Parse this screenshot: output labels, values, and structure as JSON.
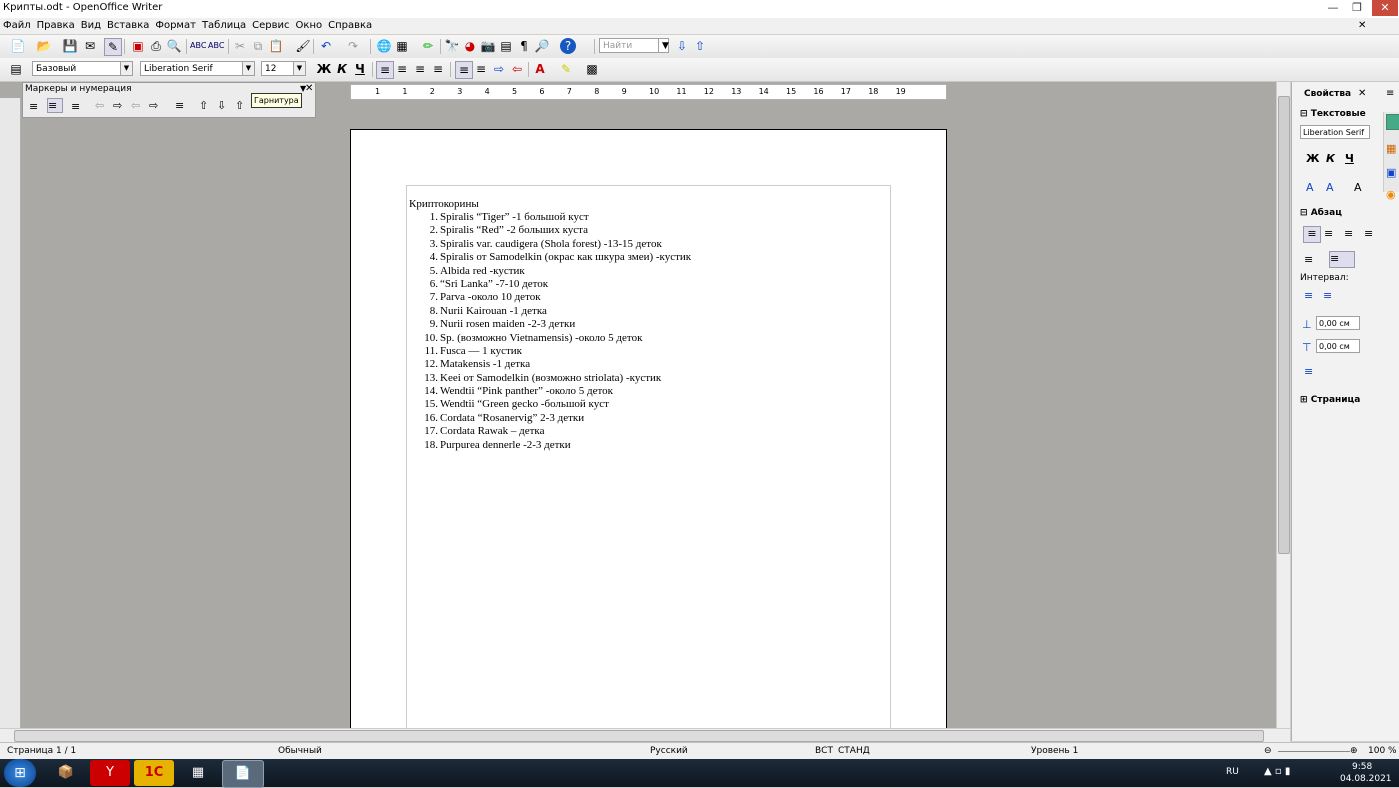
{
  "window": {
    "title": "Крипты.odt - OpenOffice Writer"
  },
  "menu": [
    "Файл",
    "Правка",
    "Вид",
    "Вставка",
    "Формат",
    "Таблица",
    "Сервис",
    "Окно",
    "Справка"
  ],
  "toolbar": {
    "search_placeholder": "Найти",
    "style_value": "Базовый",
    "font_value": "Liberation Serif",
    "size_value": "12",
    "bold_label": "Ж",
    "italic_label": "К",
    "underline_label": "Ч"
  },
  "bullets_toolbar": {
    "title": "Маркеры и нумерация",
    "tooltip": "Гарнитура"
  },
  "ruler": {
    "marks": [
      "1",
      "1",
      "2",
      "3",
      "4",
      "5",
      "6",
      "7",
      "8",
      "9",
      "10",
      "11",
      "12",
      "13",
      "14",
      "15",
      "16",
      "17",
      "18",
      "19"
    ]
  },
  "document": {
    "heading": "Криптокорины",
    "items": [
      "Spiralis “Tiger” -1 большой куст",
      "Spiralis “Red” -2 больших куста",
      "Spiralis var. caudigera (Shola forest) -13-15 деток",
      "Spiralis от Samodelkin (окрас как шкура змеи) -кустик",
      "Albida red -кустик",
      "“Sri Lanka” -7-10 деток",
      "Parva -около 10 деток",
      "Nurii Kairouan -1 детка",
      "Nurii rosen maiden -2-3 детки",
      "Sp. (возможно Vietnamensis) -около 5 деток",
      "Fusca — 1 кустик",
      "Matakensis -1 детка",
      "Keei  от Samodelkin (возможно striolata) -кустик",
      "Wendtii “Pink panther” -около 5 деток",
      "Wendtii “Green gecko -большой куст",
      "Cordata “Rosanervig” 2-3 детки",
      "Cordata Rawak – детка",
      "Purpurea dennerle -2-3 детки"
    ]
  },
  "sidebar": {
    "title": "Свойства",
    "text_section": "Текстовые",
    "font_value": "Liberation Serif",
    "bold": "Ж",
    "italic": "К",
    "underline": "Ч",
    "paragraph_section": "Абзац",
    "interval_label": "Интервал:",
    "spacing_above": "0,00 см",
    "spacing_below": "0,00 см",
    "page_section": "Страница"
  },
  "status": {
    "page": "Страница  1 / 1",
    "style": "Обычный",
    "language": "Русский",
    "insert_mode": "ВСТ",
    "selection_mode": "СТАНД",
    "level": "Уровень 1",
    "zoom": "100 %"
  },
  "taskbar": {
    "lang": "RU",
    "time": "9:58",
    "date": "04.08.2021"
  }
}
